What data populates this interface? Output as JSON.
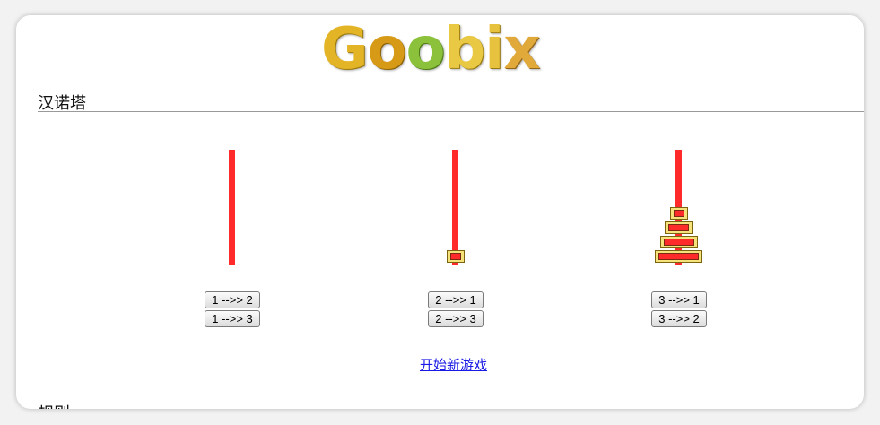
{
  "logo": {
    "text": "Goobix",
    "letters": [
      "G",
      "o",
      "o",
      "b",
      "i",
      "x"
    ]
  },
  "page_title": "汉诺塔",
  "rules_title": "规则",
  "colors": {
    "peg": "#ff2a2a",
    "disk_fill": "#ff2a2a",
    "disk_border": "#f5e27a",
    "link": "#1a1ae6"
  },
  "game": {
    "pegs": [
      {
        "id": 1,
        "disks": []
      },
      {
        "id": 2,
        "disks": [
          1
        ]
      },
      {
        "id": 3,
        "disks": [
          4,
          3,
          2,
          1
        ]
      }
    ]
  },
  "moves": {
    "peg1": [
      "1 -->> 2",
      "1 -->> 3"
    ],
    "peg2": [
      "2 -->> 1",
      "2 -->> 3"
    ],
    "peg3": [
      "3 -->> 1",
      "3 -->> 2"
    ]
  },
  "new_game_label": "开始新游戏"
}
